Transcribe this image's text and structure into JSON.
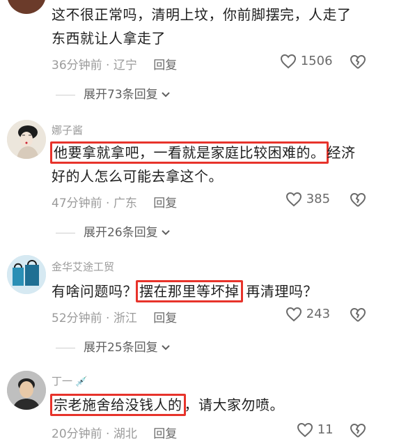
{
  "comments": [
    {
      "username": "",
      "text_lines": [
        "这不很正常吗，清明上坟，你前脚摆完，人走了",
        "东西就让人拿走了"
      ],
      "time": "36分钟前",
      "location": "辽宁",
      "reply_label": "回复",
      "likes": "1506",
      "expand_label": "展开73条回复"
    },
    {
      "username": "娜子酱",
      "text_pre": "",
      "text_highlight": "他要拿就拿吧，一看就是家庭比较困难的。",
      "text_post": "经济",
      "text_line2": "好的人怎么可能去拿这个。",
      "time": "47分钟前",
      "location": "广东",
      "reply_label": "回复",
      "likes": "385",
      "expand_label": "展开26条回复"
    },
    {
      "username": "金华艾途工贸",
      "text_pre": "有啥问题吗？",
      "text_highlight": "摆在那里等坏掉",
      "text_post": "再清理吗？",
      "time": "52分钟前",
      "location": "浙江",
      "reply_label": "回复",
      "likes": "243",
      "expand_label": "展开25条回复"
    },
    {
      "username": "丁一",
      "username_emoji": "💉",
      "text_pre": "",
      "text_highlight": "宗老施舍给没钱人的",
      "text_post": "，请大家勿喷。",
      "time": "20分钟前",
      "location": "湖北",
      "reply_label": "回复",
      "likes": "11"
    }
  ],
  "colors": {
    "highlight_border": "#e7332b",
    "meta": "#9b9b9b",
    "text": "#1f1f1f"
  },
  "icons": [
    "heart-icon",
    "broken-heart-icon",
    "chevron-down-icon"
  ]
}
